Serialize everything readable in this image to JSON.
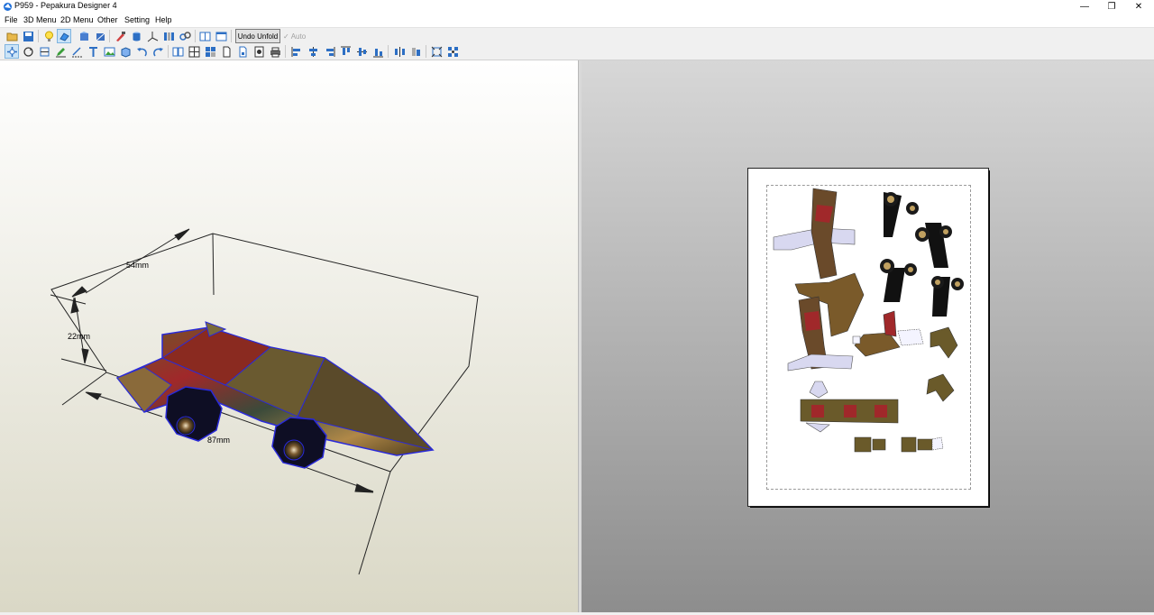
{
  "window": {
    "title": "P959 - Pepakura Designer 4"
  },
  "window_controls": {
    "minimize": "—",
    "maximize": "❐",
    "close": "✕"
  },
  "menu": [
    "File",
    "3D Menu",
    "2D Menu",
    "Other",
    "Setting",
    "Help"
  ],
  "toolbar": {
    "undo_unfold_label": "Undo Unfold",
    "auto_label": "Auto",
    "auto_checked": true,
    "auto_enabled": false
  },
  "view3d": {
    "dimensions": {
      "width": "54mm",
      "height": "22mm",
      "length": "87mm"
    },
    "background_top": "#ffffff",
    "background_bottom": "#dad8c6"
  },
  "view2d": {
    "background_top": "#d7d7d7",
    "background_bottom": "#8d8d8d",
    "paper_color": "#ffffff"
  },
  "colors": {
    "edge_blue": "#2a2ad8",
    "accent": "#1e6fd9"
  }
}
